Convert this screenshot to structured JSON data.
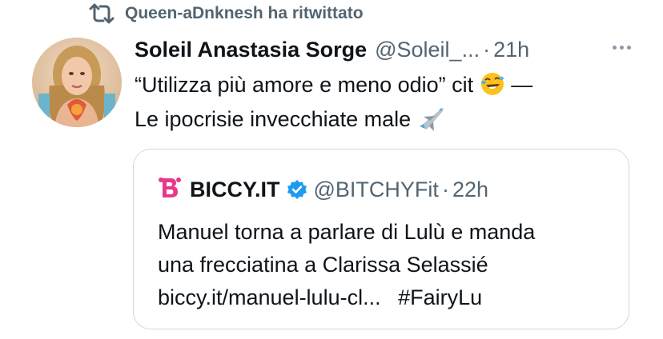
{
  "retweet": {
    "icon": "retweet-icon",
    "label": "Queen-aDnknesh ha ritwittato"
  },
  "tweet": {
    "author_name": "Soleil Anastasia Sorge",
    "author_handle": "@Soleil_...",
    "separator": "·",
    "time": "21h",
    "text_line1": "“Utilizza più amore e meno odio” cit",
    "text_emoji1": "rolling-on-floor-laughing-emoji",
    "text_dash": "—",
    "text_line2": "Le ipocrisie invecchiate male",
    "text_emoji2": "airplane-emoji"
  },
  "quote": {
    "logo_icon": "biccy-logo-icon",
    "author_name": "BICCY.IT",
    "verified_icon": "verified-badge-icon",
    "author_handle": "@BITCHYFit",
    "separator": "·",
    "time": "22h",
    "text_line1": "Manuel torna a parlare di Lulù e manda",
    "text_line2": "una frecciatina a Clarissa Selassié",
    "link": "biccy.it/manuel-lulu-cl...",
    "hashtag": "#FairyLu"
  },
  "colors": {
    "text_primary": "#0f1419",
    "text_secondary": "#536471",
    "border": "#cfd9de",
    "verified_blue": "#1d9bf0",
    "biccy_pink": "#e8388a"
  }
}
